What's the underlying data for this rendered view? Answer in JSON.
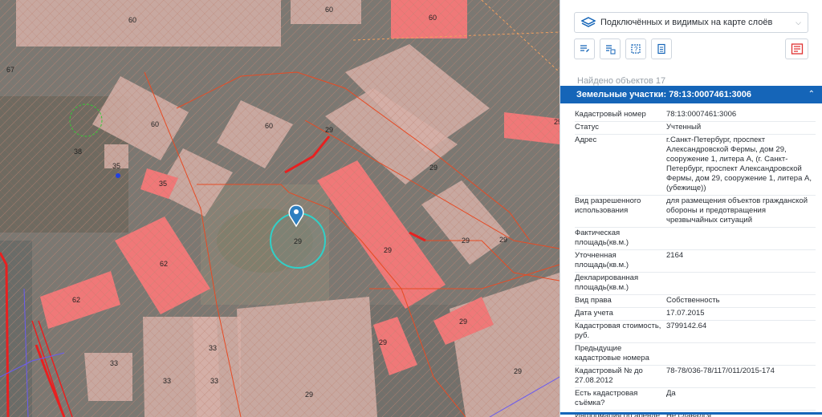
{
  "map": {
    "parcel_labels": [
      "60",
      "60",
      "60",
      "60",
      "60",
      "29",
      "29",
      "29",
      "29",
      "29",
      "29",
      "29",
      "29",
      "29",
      "35",
      "35",
      "62",
      "62",
      "33",
      "33",
      "33",
      "33",
      "29",
      "29",
      "67",
      "38"
    ]
  },
  "panel": {
    "layer_select": "Подключённых и видимых на карте слоёв",
    "found": "Найдено объектов 17",
    "section_title": "Земельные участки: 78:13:0007461:3006",
    "collapse_icon": "chevron-up",
    "colors": {
      "accent": "#1565b8",
      "parcel_red": "#f07878",
      "parcel_pink": "#d9b3ad",
      "boundary": "#e64b25"
    },
    "props": [
      {
        "k": "Кадастровый номер",
        "v": "78:13:0007461:3006"
      },
      {
        "k": "Статус",
        "v": "Учтенный"
      },
      {
        "k": "Адрес",
        "v": "г.Санкт-Петербург, проспект Александровской Фермы, дом 29, сооружение 1, литера А, (г. Санкт-Петербург, проспект Александровской Фермы, дом 29, сооружение 1, литера А, (убежище))"
      },
      {
        "k": "Вид разрешенного использования",
        "v": "для размещения объектов гражданской обороны и предотвращения чрезвычайных ситуаций"
      },
      {
        "k": "Фактическая площадь(кв.м.)",
        "v": ""
      },
      {
        "k": "Уточненная площадь(кв.м.)",
        "v": "2164"
      },
      {
        "k": "Декларированная площадь(кв.м.)",
        "v": ""
      },
      {
        "k": "Вид права",
        "v": "Собственность"
      },
      {
        "k": "Дата учета",
        "v": "17.07.2015"
      },
      {
        "k": "Кадастровая стоимость, руб.",
        "v": "3799142.64"
      },
      {
        "k": "Предыдущие кадастровые номера",
        "v": ""
      },
      {
        "k": "Кадастровый № до 27.08.2012",
        "v": "78-78/036-78/117/011/2015-174"
      },
      {
        "k": "Есть кадастровая съёмка?",
        "v": "Да"
      },
      {
        "k": "Информация об аренде",
        "v": "Не сдавался"
      }
    ]
  }
}
